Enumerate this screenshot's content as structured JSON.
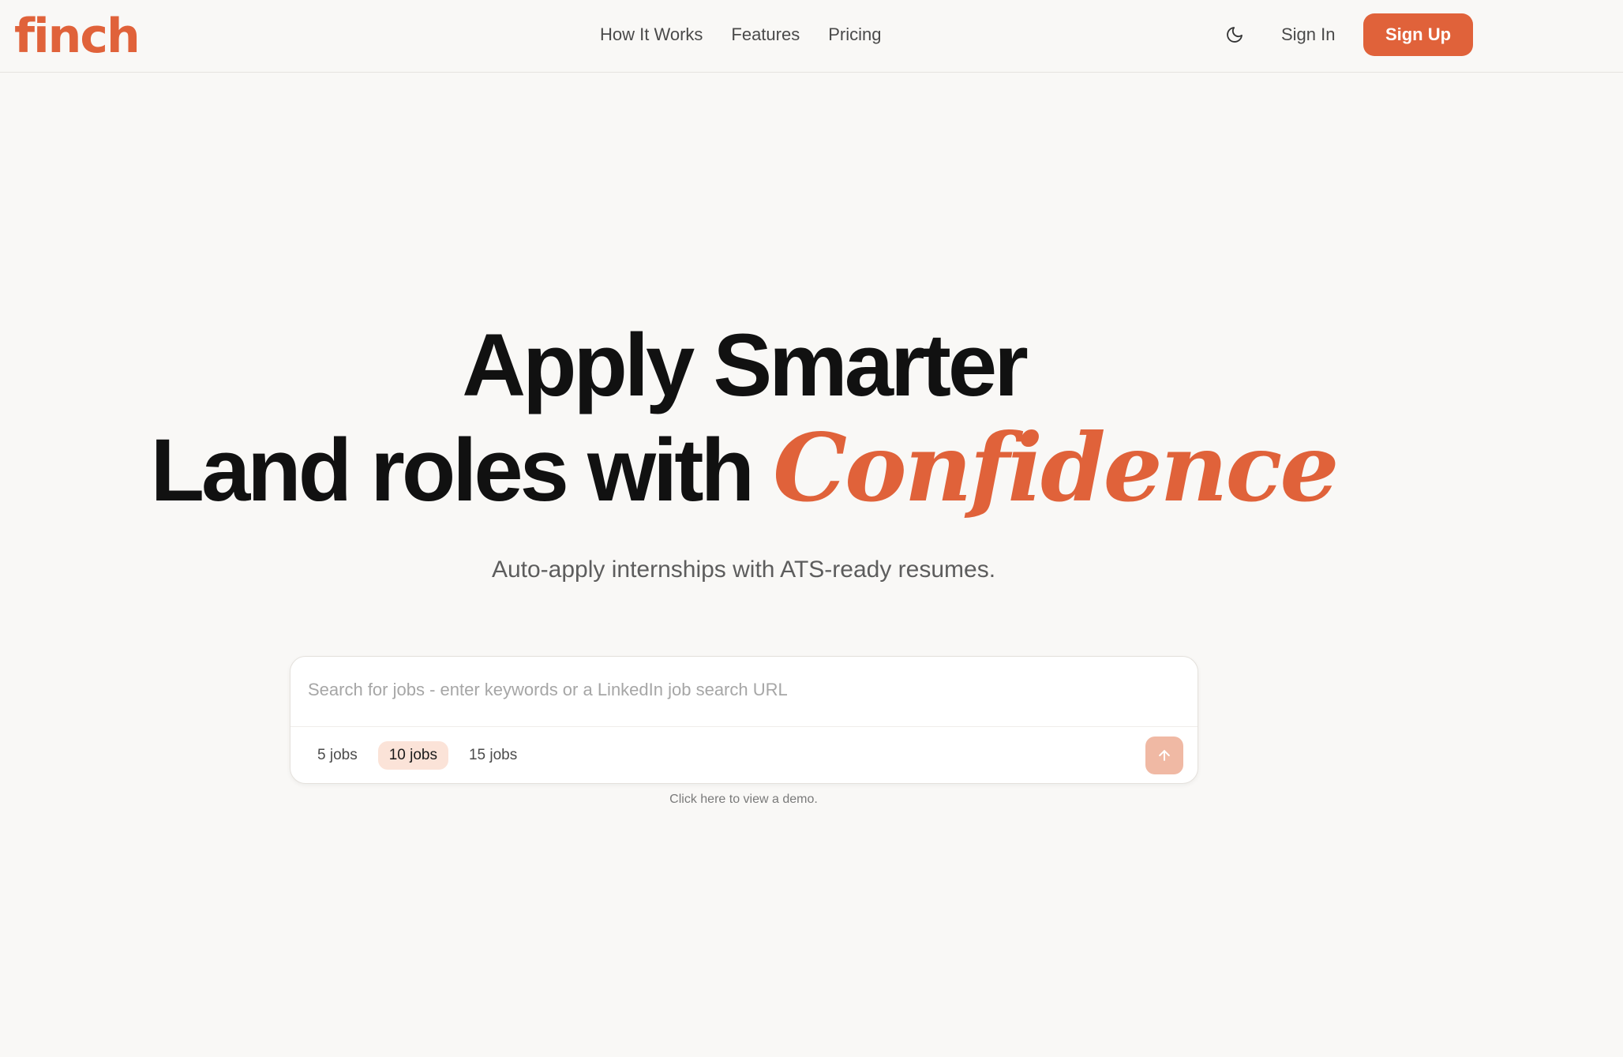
{
  "brand": {
    "logo_text": "finch",
    "accent_color": "#e0623a"
  },
  "header": {
    "nav": [
      {
        "label": "How It Works"
      },
      {
        "label": "Features"
      },
      {
        "label": "Pricing"
      }
    ],
    "theme_toggle_icon": "moon-icon",
    "sign_in_label": "Sign In",
    "sign_up_label": "Sign Up"
  },
  "hero": {
    "line1": "Apply Smarter",
    "line2_prefix": "Land roles with ",
    "line2_accent": "Confidence",
    "subtitle": "Auto-apply internships with ATS-ready resumes."
  },
  "search": {
    "placeholder": "Search for jobs - enter keywords or a LinkedIn job search URL",
    "value": "",
    "job_options": [
      {
        "label": "5 jobs",
        "selected": false
      },
      {
        "label": "10 jobs",
        "selected": true
      },
      {
        "label": "15 jobs",
        "selected": false
      }
    ],
    "submit_icon": "arrow-up-icon"
  },
  "demo_link_text": "Click here to view a demo."
}
